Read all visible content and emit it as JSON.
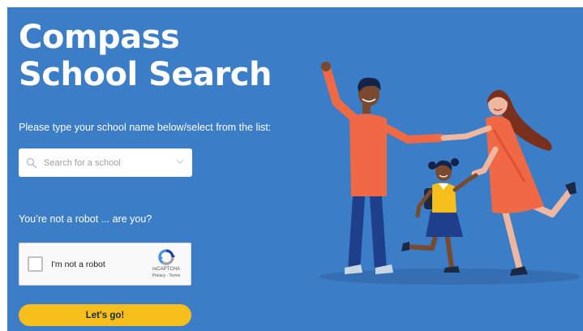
{
  "hero": {
    "title_line1": "Compass",
    "title_line2": "School Search"
  },
  "prompt": "Please type your school name below/select from the list:",
  "search": {
    "placeholder": "Search for a school"
  },
  "robot_question": "You’re not a robot ... are you?",
  "captcha": {
    "label": "I'm not a robot",
    "brand": "reCAPTCHA",
    "terms": "Privacy - Terms"
  },
  "submit_label": "Let's go!",
  "colors": {
    "background": "#3b7dc6",
    "button": "#f6be1b",
    "text": "#ffffff"
  },
  "icons": [
    "search-icon",
    "chevron-down-icon",
    "recaptcha-logo-icon"
  ]
}
